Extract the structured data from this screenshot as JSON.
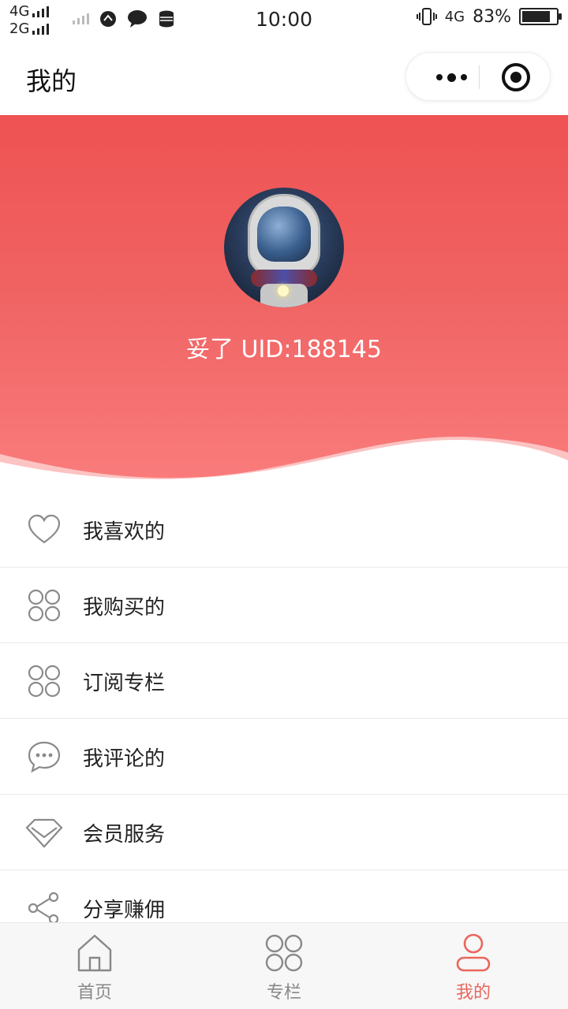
{
  "status_bar": {
    "net1": "4G",
    "net2": "2G",
    "time": "10:00",
    "net_right": "4G",
    "battery": "83%",
    "battery_level": 0.83
  },
  "nav": {
    "title": "我的"
  },
  "profile": {
    "user_line": "妥了 UID:188145"
  },
  "menu": [
    {
      "label": "我喜欢的",
      "icon": "heart-icon"
    },
    {
      "label": "我购买的",
      "icon": "grid-icon"
    },
    {
      "label": "订阅专栏",
      "icon": "grid-icon"
    },
    {
      "label": "我评论的",
      "icon": "comment-icon"
    },
    {
      "label": "会员服务",
      "icon": "diamond-icon"
    },
    {
      "label": "分享赚佣",
      "icon": "share-icon"
    }
  ],
  "tabbar": {
    "tabs": [
      {
        "label": "首页",
        "icon": "home-icon"
      },
      {
        "label": "专栏",
        "icon": "grid-icon"
      },
      {
        "label": "我的",
        "icon": "user-icon"
      }
    ],
    "active_color": "#e9665c",
    "inactive_color": "#888888"
  },
  "colors": {
    "header_top": "#ef5252",
    "header_bottom": "#fa7c7c"
  }
}
